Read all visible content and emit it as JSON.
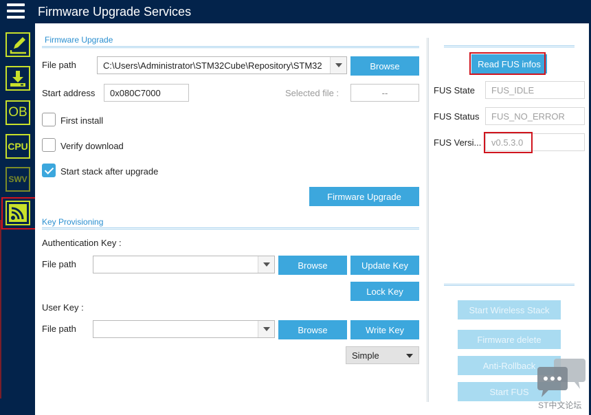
{
  "app": {
    "title": "Firmware Upgrade Services"
  },
  "sidebar": {
    "items": [
      {
        "name": "edit",
        "icon": "pencil-icon"
      },
      {
        "name": "download",
        "icon": "download-icon"
      },
      {
        "name": "option-bytes",
        "icon": "ob-icon",
        "label": "OB"
      },
      {
        "name": "cpu",
        "icon": "cpu-icon",
        "label": "CPU"
      },
      {
        "name": "swv",
        "icon": "swv-icon",
        "label": "SWV"
      },
      {
        "name": "fus",
        "icon": "wireless-icon"
      }
    ]
  },
  "firmware_upgrade": {
    "section_title": "Firmware Upgrade",
    "file_path_label": "File path",
    "file_path_value": "C:\\Users\\Administrator\\STM32Cube\\Repository\\STM32",
    "browse_label": "Browse",
    "start_address_label": "Start address",
    "start_address_value": "0x080C7000",
    "selected_file_label": "Selected file :",
    "selected_file_value": "--",
    "first_install_label": "First install",
    "first_install_checked": false,
    "verify_download_label": "Verify download",
    "verify_download_checked": false,
    "start_stack_label": "Start stack after upgrade",
    "start_stack_checked": true,
    "upgrade_button": "Firmware Upgrade"
  },
  "key_provisioning": {
    "section_title": "Key Provisioning",
    "auth_key_label": "Authentication Key :",
    "auth_file_path_label": "File path",
    "auth_file_path_value": "",
    "auth_browse_label": "Browse",
    "update_key_label": "Update Key",
    "lock_key_label": "Lock Key",
    "user_key_label": "User Key :",
    "user_file_path_label": "File path",
    "user_file_path_value": "",
    "user_browse_label": "Browse",
    "write_key_label": "Write Key",
    "key_type_value": "Simple"
  },
  "fus_panel": {
    "read_infos_button": "Read FUS infos",
    "fus_state_label": "FUS State",
    "fus_state_value": "FUS_IDLE",
    "fus_status_label": "FUS Status",
    "fus_status_value": "FUS_NO_ERROR",
    "fus_version_label": "FUS Versi...",
    "fus_version_value": "v0.5.3.0",
    "start_wireless_stack": "Start Wireless Stack",
    "firmware_delete": "Firmware delete",
    "anti_rollback": "Anti-Rollback",
    "start_fus": "Start FUS"
  },
  "watermark": {
    "text": "ST中文论坛"
  },
  "colors": {
    "navy": "#03234b",
    "accent": "#3ca7dd",
    "lime": "#c8e02a",
    "highlight": "#d0141d"
  }
}
